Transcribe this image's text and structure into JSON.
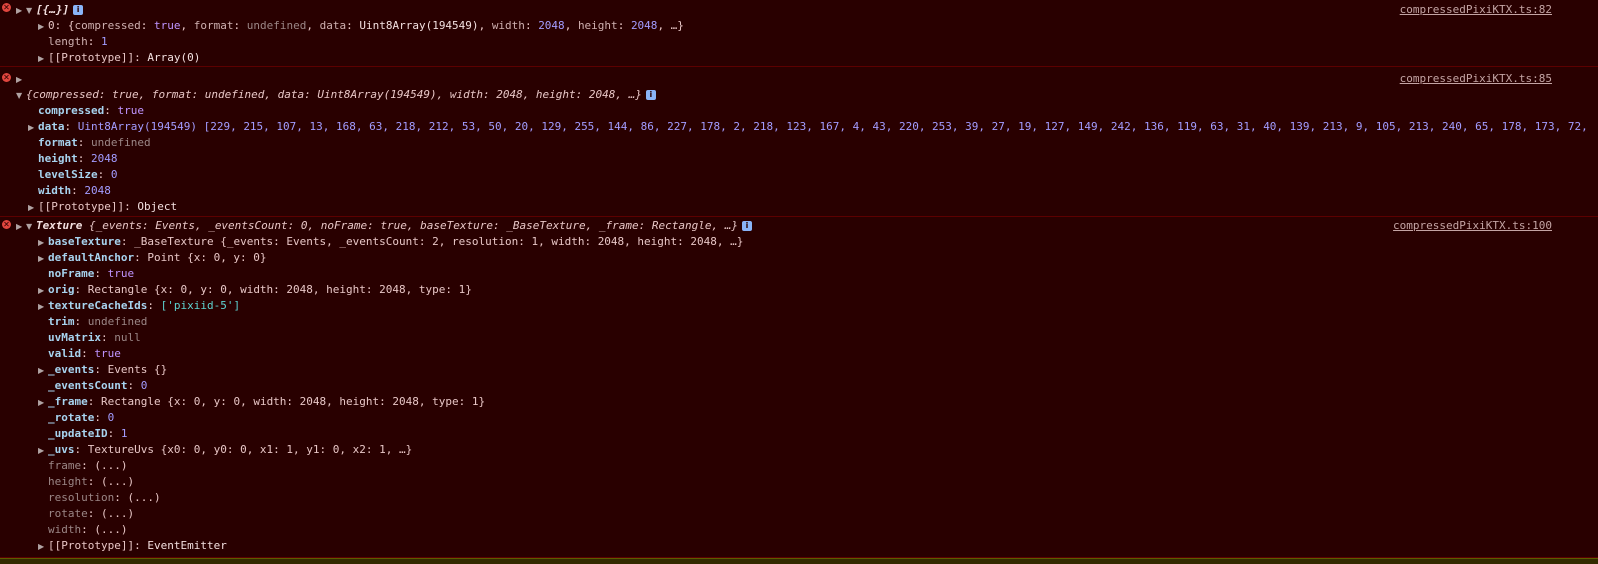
{
  "messages": [
    {
      "source": "compressedPixiKTX.ts:82",
      "summary": "[{…}]",
      "rows": [
        {
          "key": "0",
          "text": "{compressed: true, format: undefined, data: Uint8Array(194549), width: 2048, height: 2048, …}"
        },
        {
          "key": "length",
          "value": "1"
        },
        {
          "key": "[[Prototype]]",
          "value": "Array(0)"
        }
      ]
    },
    {
      "source": "compressedPixiKTX.ts:85",
      "summary": "{compressed: true, format: undefined, data: Uint8Array(194549), width: 2048, height: 2048, …}",
      "rows": [
        {
          "key": "compressed",
          "value": "true"
        },
        {
          "key": "data",
          "value": "Uint8Array(194549) [229, 215, 107, 13, 168, 63, 218, 212, 53, 50, 20, 129, 255, 144, 86, 227, 178, 2, 218, 123, 167, 4, 43, 220, 253, 39, 27, 19, 127, 149, 242, 136, 119, 63, 31, 40, 139, 213, 9, 105, 213, 240, 65, 178, 173, 72,"
        },
        {
          "key": "format",
          "value": "undefined"
        },
        {
          "key": "height",
          "value": "2048"
        },
        {
          "key": "levelSize",
          "value": "0"
        },
        {
          "key": "width",
          "value": "2048"
        },
        {
          "key": "[[Prototype]]",
          "value": "Object"
        }
      ]
    },
    {
      "source": "compressedPixiKTX.ts:100",
      "summary_class": "Texture",
      "summary": "{_events: Events, _eventsCount: 0, noFrame: true, baseTexture: _BaseTexture, _frame: Rectangle, …}",
      "rows": [
        {
          "key": "baseTexture",
          "value": "_BaseTexture {_events: Events, _eventsCount: 2, resolution: 1, width: 2048, height: 2048, …}"
        },
        {
          "key": "defaultAnchor",
          "value": "Point {x: 0, y: 0}"
        },
        {
          "key": "noFrame",
          "value": "true"
        },
        {
          "key": "orig",
          "value": "Rectangle {x: 0, y: 0, width: 2048, height: 2048, type: 1}"
        },
        {
          "key": "textureCacheIds",
          "value": "['pixiid-5']"
        },
        {
          "key": "trim",
          "value": "undefined"
        },
        {
          "key": "uvMatrix",
          "value": "null"
        },
        {
          "key": "valid",
          "value": "true"
        },
        {
          "key": "_events",
          "value": "Events {}"
        },
        {
          "key": "_eventsCount",
          "value": "0"
        },
        {
          "key": "_frame",
          "value": "Rectangle {x: 0, y: 0, width: 2048, height: 2048, type: 1}"
        },
        {
          "key": "_rotate",
          "value": "0"
        },
        {
          "key": "_updateID",
          "value": "1"
        },
        {
          "key": "_uvs",
          "value": "TextureUvs {x0: 0, y0: 0, x1: 1, y1: 0, x2: 1, …}"
        },
        {
          "key": "frame",
          "value": "(...)"
        },
        {
          "key": "height",
          "value": "(...)"
        },
        {
          "key": "resolution",
          "value": "(...)"
        },
        {
          "key": "rotate",
          "value": "(...)"
        },
        {
          "key": "width",
          "value": "(...)"
        },
        {
          "key": "[[Prototype]]",
          "value": "EventEmitter"
        }
      ]
    }
  ],
  "colors": {
    "background": "#290000",
    "error_icon": "#e2463f",
    "key": "#a7d3ef",
    "number": "#a39cff",
    "boolean": "#c095ff",
    "string": "#5ed3d1"
  },
  "icons": {
    "error": "error-circle-icon",
    "expand": "triangle-right-icon",
    "collapse": "triangle-down-icon",
    "info": "info-badge-icon"
  }
}
